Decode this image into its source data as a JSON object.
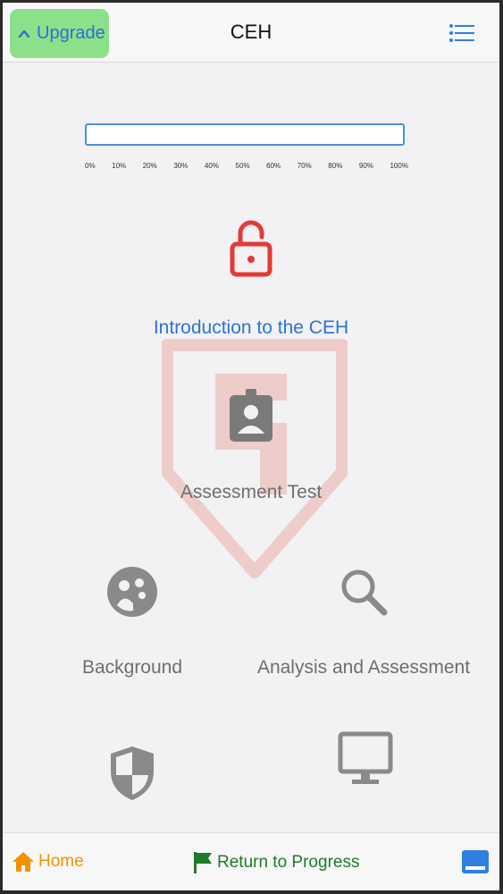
{
  "header": {
    "upgrade_label": "Upgrade",
    "title": "CEH",
    "icons": {
      "upgrade": "chevron-up-icon",
      "menu": "list-menu-icon"
    }
  },
  "progress": {
    "value_percent": 0,
    "ticks": [
      "0%",
      "10%",
      "20%",
      "30%",
      "40%",
      "50%",
      "60%",
      "70%",
      "80%",
      "90%",
      "100%"
    ]
  },
  "items": [
    {
      "label": "Introduction to the CEH",
      "icon": "unlocked-padlock-icon",
      "state": "active"
    },
    {
      "label": "Assessment Test",
      "icon": "id-badge-icon",
      "state": "locked"
    },
    {
      "label": "Background",
      "icon": "group-icon",
      "state": "locked"
    },
    {
      "label": "Analysis and Assessment",
      "icon": "magnifier-icon",
      "state": "locked"
    },
    {
      "label": "",
      "icon": "shield-icon",
      "state": "locked"
    },
    {
      "label": "",
      "icon": "monitor-icon",
      "state": "locked"
    }
  ],
  "footer": {
    "home_label": "Home",
    "return_label": "Return to Progress",
    "icons": {
      "home": "home-icon",
      "return": "flag-icon",
      "panel": "panel-icon"
    }
  },
  "colors": {
    "accent_blue": "#2a73d9",
    "upgrade_green": "#8de08a",
    "lock_red": "#e53935",
    "home_orange": "#f39200",
    "flag_green": "#1f7a2a",
    "muted_gray": "#6f6f6f"
  }
}
